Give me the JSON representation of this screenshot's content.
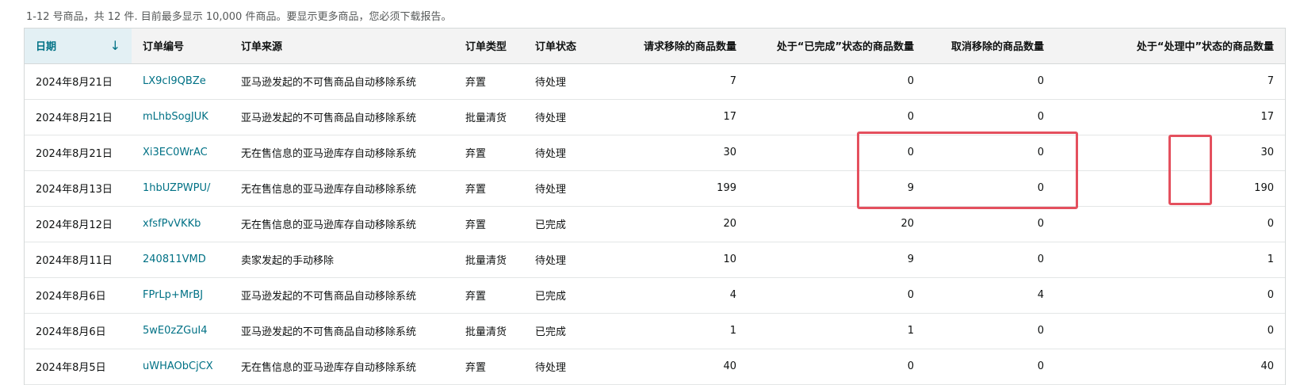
{
  "summary": "1-12 号商品，共 12 件. 目前最多显示 10,000 件商品。要显示更多商品，您必须下载报告。",
  "columns": {
    "date": "日期",
    "order_id": "订单编号",
    "source": "订单来源",
    "type": "订单类型",
    "status": "订单状态",
    "requested": "请求移除的商品数量",
    "completed": "处于“已完成”状态的商品数量",
    "cancelled": "取消移除的商品数量",
    "in_process": "处于“处理中”状态的商品数量"
  },
  "sort_icon": "arrow-down-icon",
  "highlight_color": "#e4505e",
  "rows": [
    {
      "date": "2024年8月21日",
      "order_id": "LX9cI9QBZe",
      "source": "亚马逊发起的不可售商品自动移除系统",
      "type": "弃置",
      "status": "待处理",
      "requested": "7",
      "completed": "0",
      "cancelled": "0",
      "in_process": "7"
    },
    {
      "date": "2024年8月21日",
      "order_id": "mLhbSogJUK",
      "source": "亚马逊发起的不可售商品自动移除系统",
      "type": "批量清货",
      "status": "待处理",
      "requested": "17",
      "completed": "0",
      "cancelled": "0",
      "in_process": "17"
    },
    {
      "date": "2024年8月21日",
      "order_id": "Xi3EC0WrAC",
      "source": "无在售信息的亚马逊库存自动移除系统",
      "type": "弃置",
      "status": "待处理",
      "requested": "30",
      "completed": "0",
      "cancelled": "0",
      "in_process": "30"
    },
    {
      "date": "2024年8月13日",
      "order_id": "1hbUZPWPU/",
      "source": "无在售信息的亚马逊库存自动移除系统",
      "type": "弃置",
      "status": "待处理",
      "requested": "199",
      "completed": "9",
      "cancelled": "0",
      "in_process": "190"
    },
    {
      "date": "2024年8月12日",
      "order_id": "xfsfPvVKKb",
      "source": "无在售信息的亚马逊库存自动移除系统",
      "type": "弃置",
      "status": "已完成",
      "requested": "20",
      "completed": "20",
      "cancelled": "0",
      "in_process": "0"
    },
    {
      "date": "2024年8月11日",
      "order_id": "240811VMD",
      "source": "卖家发起的手动移除",
      "type": "批量清货",
      "status": "待处理",
      "requested": "10",
      "completed": "9",
      "cancelled": "0",
      "in_process": "1"
    },
    {
      "date": "2024年8月6日",
      "order_id": "FPrLp+MrBJ",
      "source": "亚马逊发起的不可售商品自动移除系统",
      "type": "弃置",
      "status": "已完成",
      "requested": "4",
      "completed": "0",
      "cancelled": "4",
      "in_process": "0"
    },
    {
      "date": "2024年8月6日",
      "order_id": "5wE0zZGuI4",
      "source": "亚马逊发起的不可售商品自动移除系统",
      "type": "批量清货",
      "status": "已完成",
      "requested": "1",
      "completed": "1",
      "cancelled": "0",
      "in_process": "0"
    },
    {
      "date": "2024年8月5日",
      "order_id": "uWHAObCjCX",
      "source": "无在售信息的亚马逊库存自动移除系统",
      "type": "弃置",
      "status": "待处理",
      "requested": "40",
      "completed": "0",
      "cancelled": "0",
      "in_process": "40"
    }
  ]
}
